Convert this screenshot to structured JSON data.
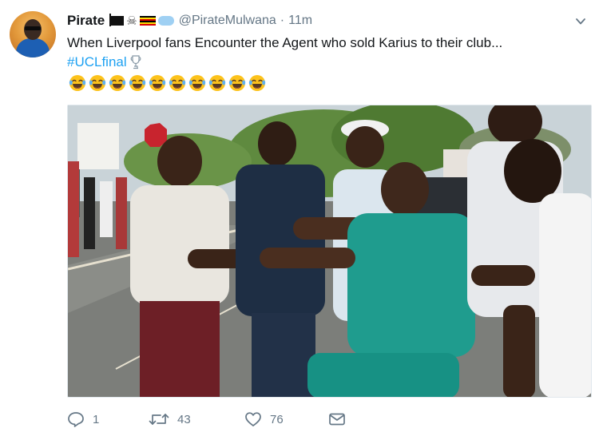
{
  "tweet": {
    "author_name": "Pirate",
    "handle": "@PirateMulwana",
    "separator": "·",
    "time": "11m",
    "text": "When Liverpool fans Encounter the Agent who sold Karius to their club...",
    "hashtag": "#UCLfinal",
    "emoji_count": 10
  },
  "actions": {
    "reply_count": "1",
    "retweet_count": "43",
    "like_count": "76"
  },
  "icons": {
    "reply": "reply-icon",
    "retweet": "retweet-icon",
    "like": "heart-icon",
    "dm": "envelope-icon",
    "menu": "chevron-down-icon"
  },
  "colors": {
    "link": "#1da1f2",
    "muted": "#657786",
    "text": "#14171a"
  }
}
